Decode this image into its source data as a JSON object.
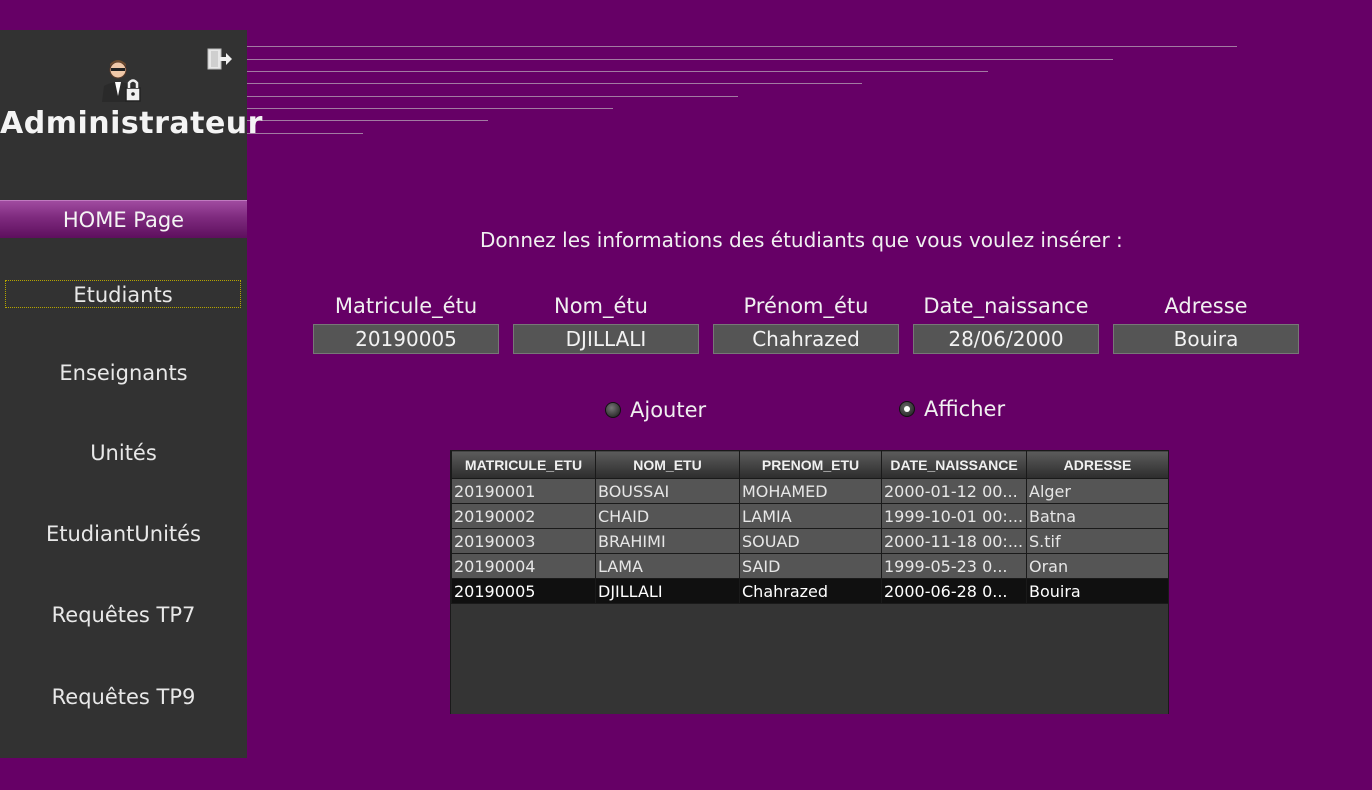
{
  "sidebar": {
    "admin_title": "Administrateur",
    "home_label": "HOME Page",
    "items": [
      {
        "label": "Etudiants",
        "active": true
      },
      {
        "label": "Enseignants"
      },
      {
        "label": "Unités"
      },
      {
        "label": "EtudiantUnités"
      },
      {
        "label": "Requêtes TP7"
      },
      {
        "label": "Requêtes TP9"
      }
    ],
    "icons": {
      "admin": "admin-lock-icon",
      "logout": "logout-icon"
    }
  },
  "form": {
    "prompt": "Donnez les informations des étudiants que vous voulez insérer :",
    "fields": [
      {
        "label": "Matricule_étu",
        "value": "20190005"
      },
      {
        "label": "Nom_étu",
        "value": "DJILLALI"
      },
      {
        "label": "Prénom_étu",
        "value": "Chahrazed"
      },
      {
        "label": "Date_naissance",
        "value": "28/06/2000"
      },
      {
        "label": "Adresse",
        "value": "Bouira"
      }
    ],
    "radios": [
      {
        "label": "Ajouter",
        "checked": false
      },
      {
        "label": "Afficher",
        "checked": true
      }
    ]
  },
  "table": {
    "headers": [
      "MATRICULE_ETU",
      "NOM_ETU",
      "PRENOM_ETU",
      "DATE_NAISSANCE",
      "ADRESSE"
    ],
    "rows": [
      [
        "20190001",
        "BOUSSAI",
        "MOHAMED",
        "2000-01-12 00...",
        "Alger"
      ],
      [
        "20190002",
        "CHAID",
        "LAMIA",
        "1999-10-01 00:...",
        "Batna"
      ],
      [
        "20190003",
        "BRAHIMI",
        "SOUAD",
        "2000-11-18 00:...",
        "S.tif"
      ],
      [
        "20190004",
        "LAMA",
        "SAID",
        "1999-05-23 0...",
        "Oran"
      ],
      [
        "20190005",
        "DJILLALI",
        "Chahrazed",
        "2000-06-28 0...",
        "Bouira"
      ]
    ],
    "selected_row": 4
  },
  "colors": {
    "background": "#660066",
    "sidebar": "#323232",
    "home_button": "#7e2a7e",
    "active_border": "#b5a500",
    "input_bg": "#555555",
    "selected_row": "#101010"
  }
}
